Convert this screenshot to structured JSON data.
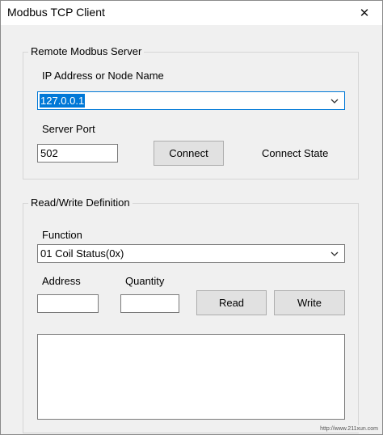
{
  "window": {
    "title": "Modbus TCP Client",
    "close_glyph": "✕"
  },
  "server_group": {
    "legend": "Remote Modbus Server",
    "ip_label": "IP Address or Node Name",
    "ip_value": "127.0.0.1",
    "port_label": "Server Port",
    "port_value": "502",
    "connect_button": "Connect",
    "connect_state": "Connect State"
  },
  "rw_group": {
    "legend": "Read/Write Definition",
    "function_label": "Function",
    "function_value": "01 Coil Status(0x)",
    "address_label": "Address",
    "address_value": "",
    "quantity_label": "Quantity",
    "quantity_value": "",
    "read_button": "Read",
    "write_button": "Write",
    "output_text": ""
  },
  "watermark": "http://www.211xun.com",
  "colors": {
    "selection": "#0078d7",
    "background": "#f0f0f0",
    "button": "#e1e1e1"
  },
  "icons": {
    "close": "close-icon",
    "dropdown": "chevron-down-icon"
  }
}
